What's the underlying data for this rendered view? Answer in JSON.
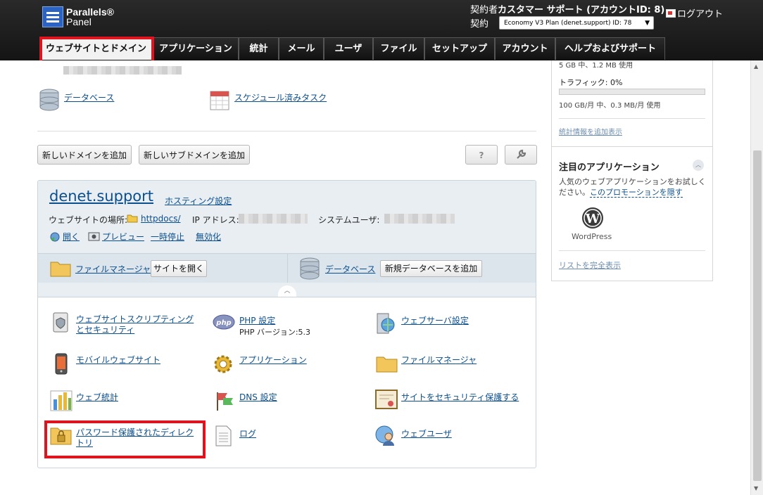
{
  "brand": {
    "line1": "Parallels®",
    "line2": "Panel"
  },
  "account": {
    "label": "契約者",
    "name": "カスタマー サポート (アカウントID: 8)",
    "contract_label": "契約",
    "plan": "Economy V3 Plan (denet.support) ID: 78",
    "logout": "ログアウト"
  },
  "tabs": [
    "ウェブサイトとドメイン",
    "アプリケーション",
    "統計",
    "メール",
    "ユーザ",
    "ファイル",
    "セットアップ",
    "アカウント",
    "ヘルプおよびサポート"
  ],
  "top_links": {
    "database": "データベース",
    "scheduled": "スケジュール済みタスク"
  },
  "buttons": {
    "add_domain": "新しいドメインを追加",
    "add_subdomain": "新しいサブドメインを追加",
    "help": "?"
  },
  "domain": {
    "name": "denet.support",
    "hosting": "ホスティング設定",
    "location_label": "ウェブサイトの場所:",
    "location": "httpdocs/",
    "ip_label": "IP アドレス:",
    "sysuser_label": "システムユーザ:",
    "actions": [
      "開く",
      "プレビュー",
      "一時停止",
      "無効化"
    ],
    "tools": {
      "file_manager": "ファイルマネージャ",
      "open_site": "サイトを開く",
      "database": "データベース",
      "add_db": "新規データベースを追加"
    }
  },
  "features": [
    {
      "label": "ウェブサイトスクリプティングとセキュリティ",
      "sub": ""
    },
    {
      "label": "PHP 設定",
      "sub": "PHP バージョン:5.3"
    },
    {
      "label": "ウェブサーバ設定",
      "sub": ""
    },
    {
      "label": "モバイルウェブサイト",
      "sub": ""
    },
    {
      "label": "アプリケーション",
      "sub": ""
    },
    {
      "label": "ファイルマネージャ",
      "sub": ""
    },
    {
      "label": "ウェブ統計",
      "sub": ""
    },
    {
      "label": "DNS 設定",
      "sub": ""
    },
    {
      "label": "サイトをセキュリティ保護する",
      "sub": ""
    },
    {
      "label": "パスワード保護されたディレクトリ",
      "sub": ""
    },
    {
      "label": "ログ",
      "sub": ""
    },
    {
      "label": "ウェブユーザ",
      "sub": ""
    }
  ],
  "stats": {
    "disk_text": "5 GB 中、1.2 MB 使用",
    "traffic_label": "トラフィック: 0%",
    "traffic_text": "100 GB/月 中、0.3 MB/月 使用",
    "more": "統計情報を追加表示"
  },
  "featured": {
    "title": "注目のアプリケーション",
    "desc": "人気のウェブアプリケーションをお試しください。",
    "hide": "このプロモーションを隠す",
    "app": "WordPress",
    "full_list": "リストを完全表示"
  },
  "colors": {
    "highlight": "#e0141e",
    "link": "#0b4f8e"
  }
}
